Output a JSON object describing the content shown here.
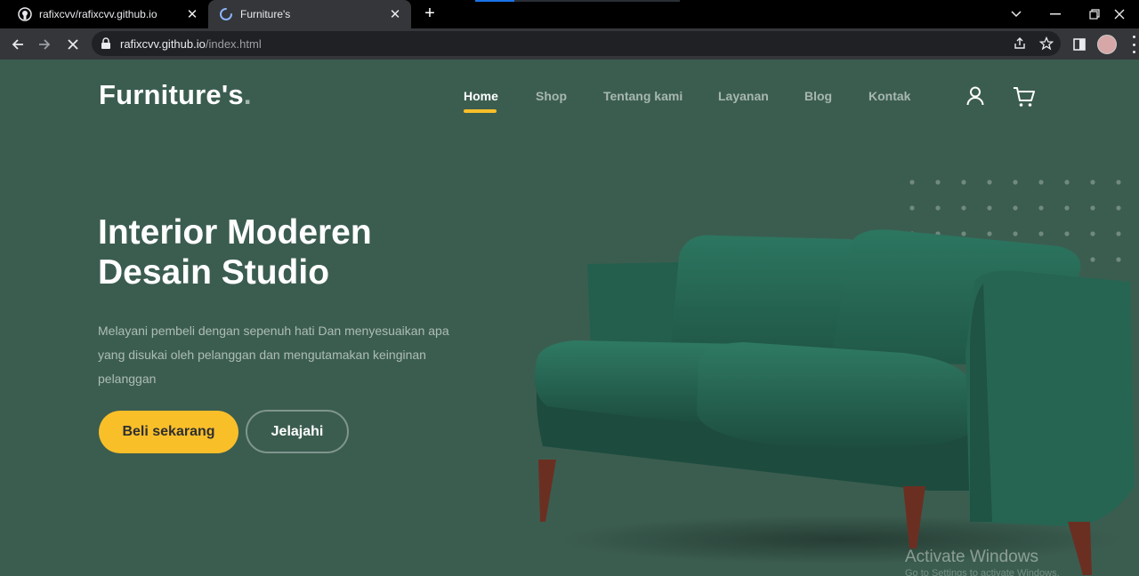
{
  "browser": {
    "tabs": [
      {
        "title": "rafixcvv/rafixcvv.github.io",
        "icon": "github-icon",
        "active": false
      },
      {
        "title": "Furniture's",
        "icon": "loading-spinner-icon",
        "active": true
      }
    ],
    "url_host": "rafixcvv.github.io",
    "url_path": "/index.html"
  },
  "header": {
    "logo": "Furniture's",
    "logo_dot": ".",
    "nav": [
      "Home",
      "Shop",
      "Tentang kami",
      "Layanan",
      "Blog",
      "Kontak"
    ],
    "active_nav": "Home"
  },
  "hero": {
    "title_line1": "Interior Moderen",
    "title_line2": "Desain Studio",
    "description": "Melayani pembeli dengan sepenuh hati Dan menyesuaikan apa yang disukai oleh pelanggan dan mengutamakan keinginan pelanggan",
    "primary_button": "Beli sekarang",
    "secondary_button": "Jelajahi"
  },
  "watermark": {
    "line1": "Activate Windows",
    "line2": "Go to Settings to activate Windows."
  },
  "colors": {
    "page_bg": "#3b5d50",
    "accent": "#f9bf29",
    "sofa": "#2e6a58"
  }
}
